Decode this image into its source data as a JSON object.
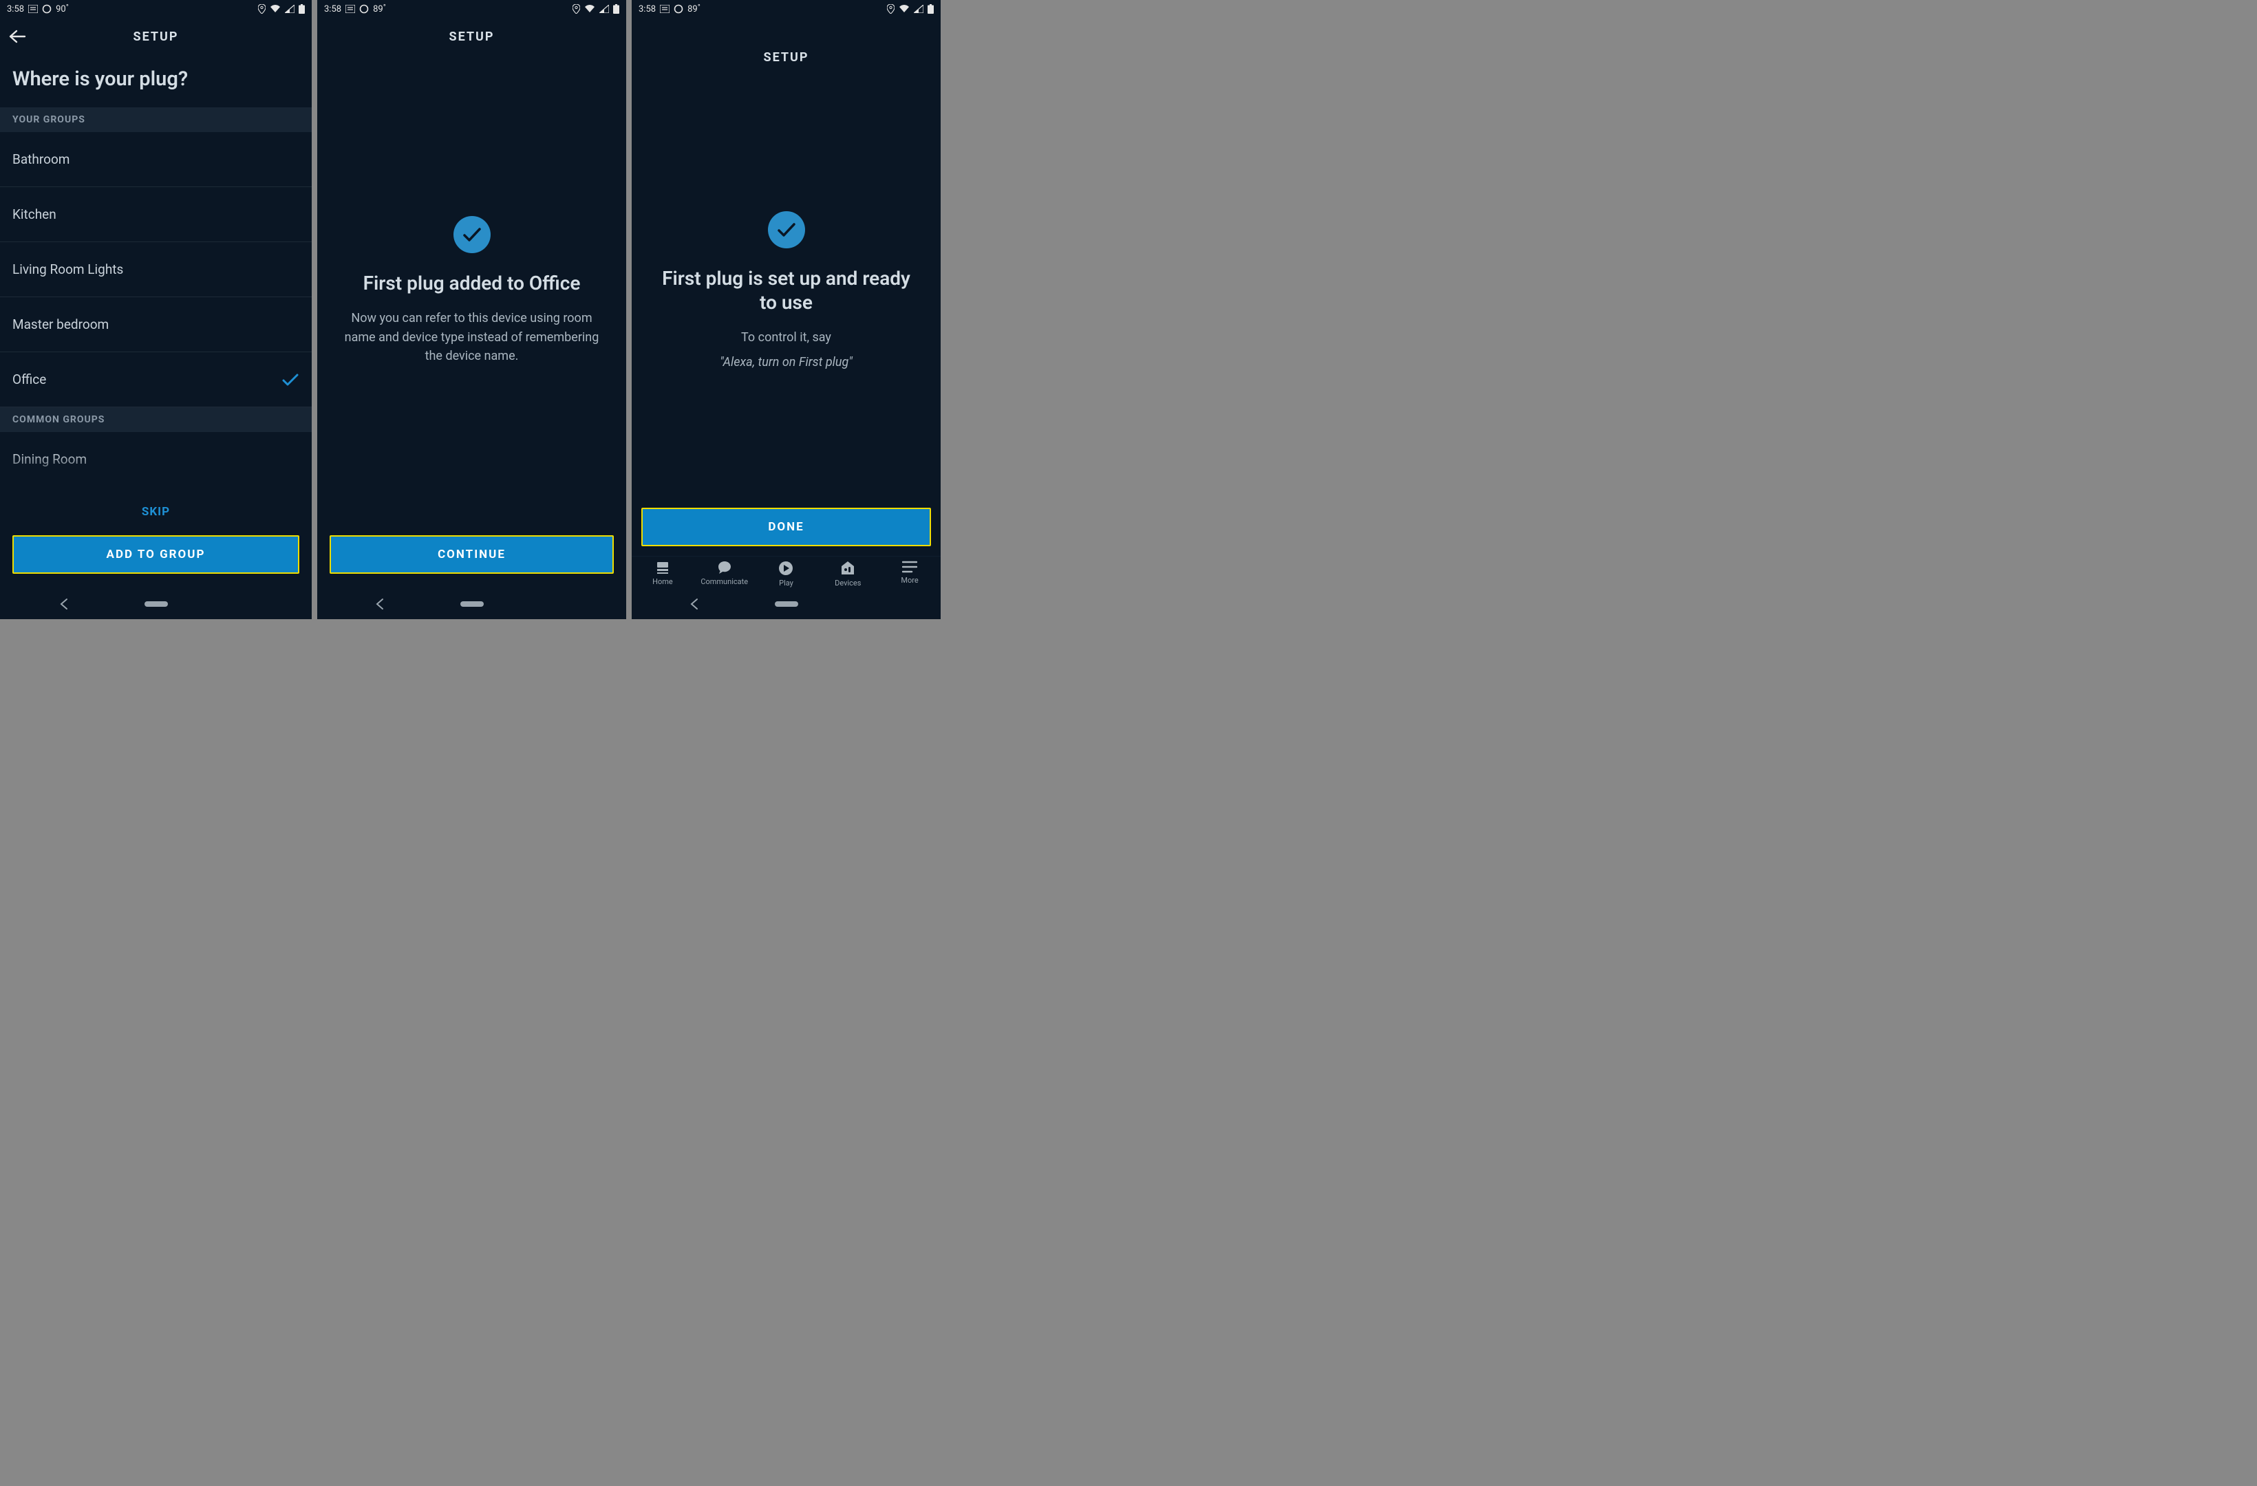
{
  "screen1": {
    "status": {
      "time": "3:58",
      "temp": "90",
      "deg": "°"
    },
    "header": {
      "title": "SETUP"
    },
    "heading": "Where is your plug?",
    "sections": {
      "your_groups_label": "YOUR GROUPS",
      "common_groups_label": "COMMON GROUPS"
    },
    "groups": [
      {
        "name": "Bathroom",
        "selected": false
      },
      {
        "name": "Kitchen",
        "selected": false
      },
      {
        "name": "Living Room Lights",
        "selected": false
      },
      {
        "name": "Master bedroom",
        "selected": false
      },
      {
        "name": "Office",
        "selected": true
      }
    ],
    "common_groups": [
      {
        "name": "Dining Room"
      }
    ],
    "skip": "SKIP",
    "button": "ADD TO GROUP"
  },
  "screen2": {
    "status": {
      "time": "3:58",
      "temp": "89",
      "deg": "°"
    },
    "header": {
      "title": "SETUP"
    },
    "title": "First plug added to Office",
    "sub": "Now you can refer to this device using room name and device type instead of remembering the device name.",
    "button": "CONTINUE"
  },
  "screen3": {
    "status": {
      "time": "3:58",
      "temp": "89",
      "deg": "°"
    },
    "header": {
      "title": "SETUP"
    },
    "title": "First plug is set up and ready to use",
    "sub1": "To control it, say",
    "sub2": "\"Alexa, turn on First plug\"",
    "button": "DONE",
    "nav": {
      "home": "Home",
      "communicate": "Communicate",
      "play": "Play",
      "devices": "Devices",
      "more": "More"
    }
  }
}
